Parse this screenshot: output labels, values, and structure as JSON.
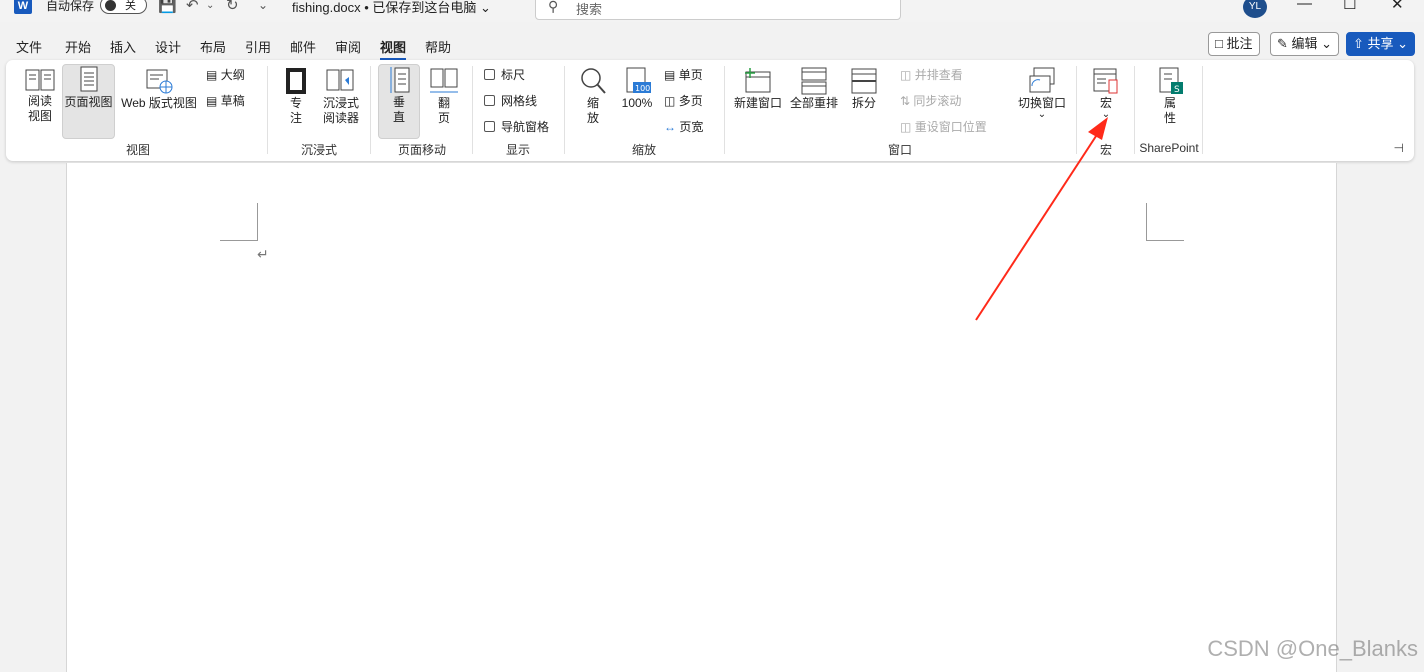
{
  "titlebar": {
    "app_icon": "W",
    "autosave_label": "自动保存",
    "autosave_state": "关",
    "filename": "fishing.docx • 已保存到这台电脑",
    "search_placeholder": "搜索",
    "user_initials": "YL",
    "icons": [
      "save-icon",
      "undo-icon",
      "redo-icon",
      "customize-quick-access-icon"
    ]
  },
  "menu": {
    "tabs": [
      "文件",
      "开始",
      "插入",
      "设计",
      "布局",
      "引用",
      "邮件",
      "审阅",
      "视图",
      "帮助"
    ],
    "active_tab": "视图",
    "comment_button": "批注",
    "edit_button": "编辑",
    "share_button": "共享"
  },
  "ribbon": {
    "views": {
      "read_mode": "阅读\n视图",
      "print_layout": "页面视图",
      "web_layout": "Web 版式视图",
      "outline": "大纲",
      "draft": "草稿",
      "label": "视图"
    },
    "immersive": {
      "focus": "专\n注",
      "reader": "沉浸式\n阅读器",
      "label": "沉浸式"
    },
    "page_movement": {
      "vertical": "垂\n直",
      "side_to_side": "翻\n页",
      "label": "页面移动"
    },
    "show": {
      "ruler": "标尺",
      "gridlines": "网格线",
      "nav_pane": "导航窗格",
      "label": "显示"
    },
    "zoom": {
      "zoom": "缩\n放",
      "hundred": "100%",
      "one_page": "单页",
      "multiple_pages": "多页",
      "page_width": "页宽",
      "label": "缩放",
      "badge": "100"
    },
    "window": {
      "new_window": "新建窗口",
      "arrange_all": "全部重排",
      "split": "拆分",
      "side_by_side": "并排查看",
      "sync_scroll": "同步滚动",
      "reset_position": "重设窗口位置",
      "switch_windows": "切换窗口",
      "label": "窗口"
    },
    "macros": {
      "macros": "宏",
      "label": "宏"
    },
    "sharepoint": {
      "properties": "属\n性",
      "label": "SharePoint"
    }
  },
  "watermark": "CSDN @One_Blanks",
  "colors": {
    "accent": "#185abd",
    "arrow": "#ff2a1a"
  }
}
